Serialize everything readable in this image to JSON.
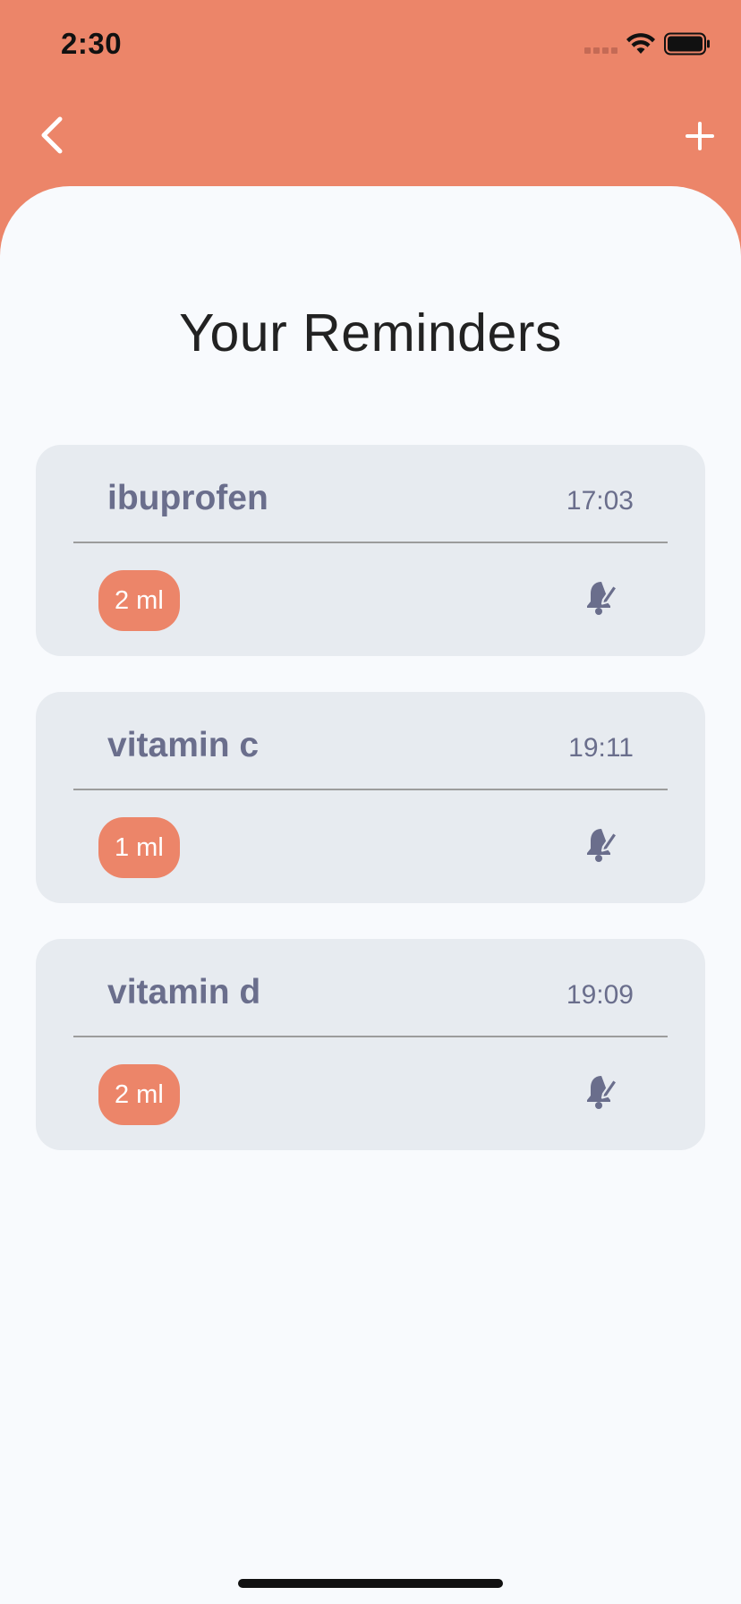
{
  "status_bar": {
    "time": "2:30"
  },
  "nav": {
    "back_icon": "chevron-left-icon",
    "add_icon": "plus-icon"
  },
  "page": {
    "title": "Your Reminders"
  },
  "reminders": [
    {
      "name": "ibuprofen",
      "time": "17:03",
      "dose": "2 ml",
      "action_icon": "bell-edit-icon"
    },
    {
      "name": "vitamin c",
      "time": "19:11",
      "dose": "1 ml",
      "action_icon": "bell-edit-icon"
    },
    {
      "name": "vitamin d",
      "time": "19:09",
      "dose": "2 ml",
      "action_icon": "bell-edit-icon"
    }
  ],
  "colors": {
    "accent": "#ec8569",
    "card_bg": "#e7ebf0",
    "card_text": "#6a6e8c",
    "sheet_bg": "#f8fafd"
  }
}
